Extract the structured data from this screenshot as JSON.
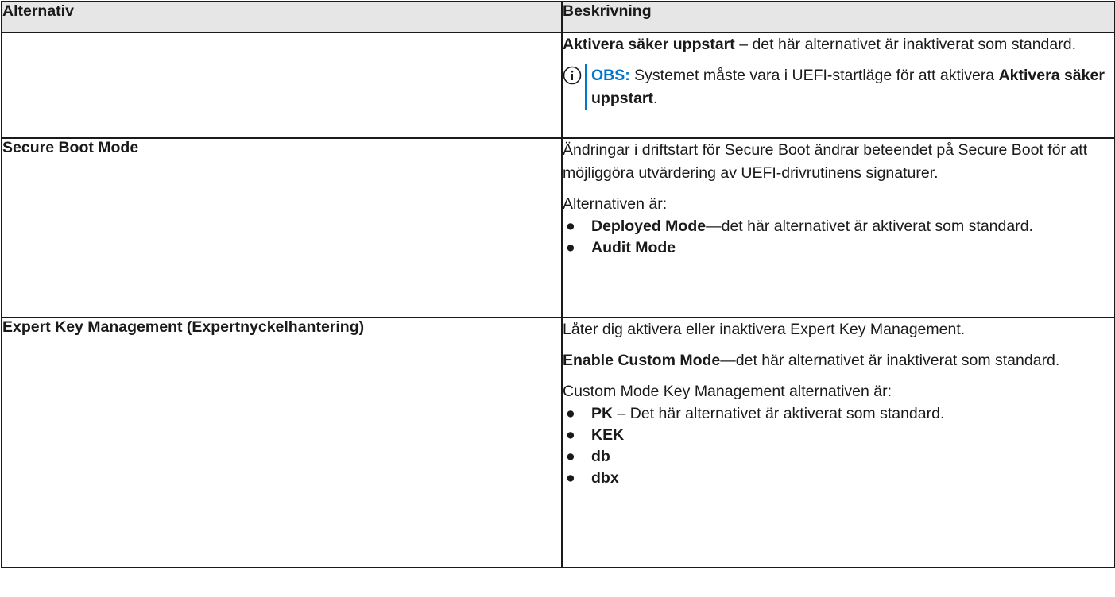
{
  "table": {
    "headers": {
      "option": "Alternativ",
      "description": "Beskrivning"
    },
    "row1": {
      "option": "",
      "para1": {
        "bold": "Aktivera säker uppstart",
        "text": " – det här alternativet är inaktiverat som standard."
      },
      "note": {
        "icon": "info-circle-icon",
        "label": "OBS:",
        "text": " Systemet måste vara i UEFI-startläge för att aktivera ",
        "bold": "Aktivera säker uppstart",
        "tail": "."
      }
    },
    "row2": {
      "option": "Secure Boot Mode",
      "para1": "Ändringar i driftstart för Secure Boot ändrar beteendet på Secure Boot för att möjliggöra utvärdering av UEFI-drivrutinens signaturer.",
      "intro": "Alternativen är:",
      "items": [
        {
          "bold": "Deployed Mode",
          "text": "—det här alternativet är aktiverat som standard."
        },
        {
          "bold": "Audit Mode",
          "text": ""
        }
      ]
    },
    "row3": {
      "option": "Expert Key Management (Expertnyckelhantering)",
      "para1": "Låter dig aktivera eller inaktivera Expert Key Management.",
      "para2": {
        "bold": "Enable Custom Mode",
        "text": "—det här alternativet är inaktiverat som standard."
      },
      "intro": "Custom Mode Key Management alternativen är:",
      "items": [
        {
          "bold": "PK",
          "text": " – Det här alternativet är aktiverat som standard."
        },
        {
          "bold": "KEK",
          "text": ""
        },
        {
          "bold": "db",
          "text": ""
        },
        {
          "bold": "dbx",
          "text": ""
        }
      ]
    }
  },
  "colors": {
    "note_accent": "#0076ce",
    "header_bg": "#e6e6e6",
    "border": "#1a1a1a"
  }
}
